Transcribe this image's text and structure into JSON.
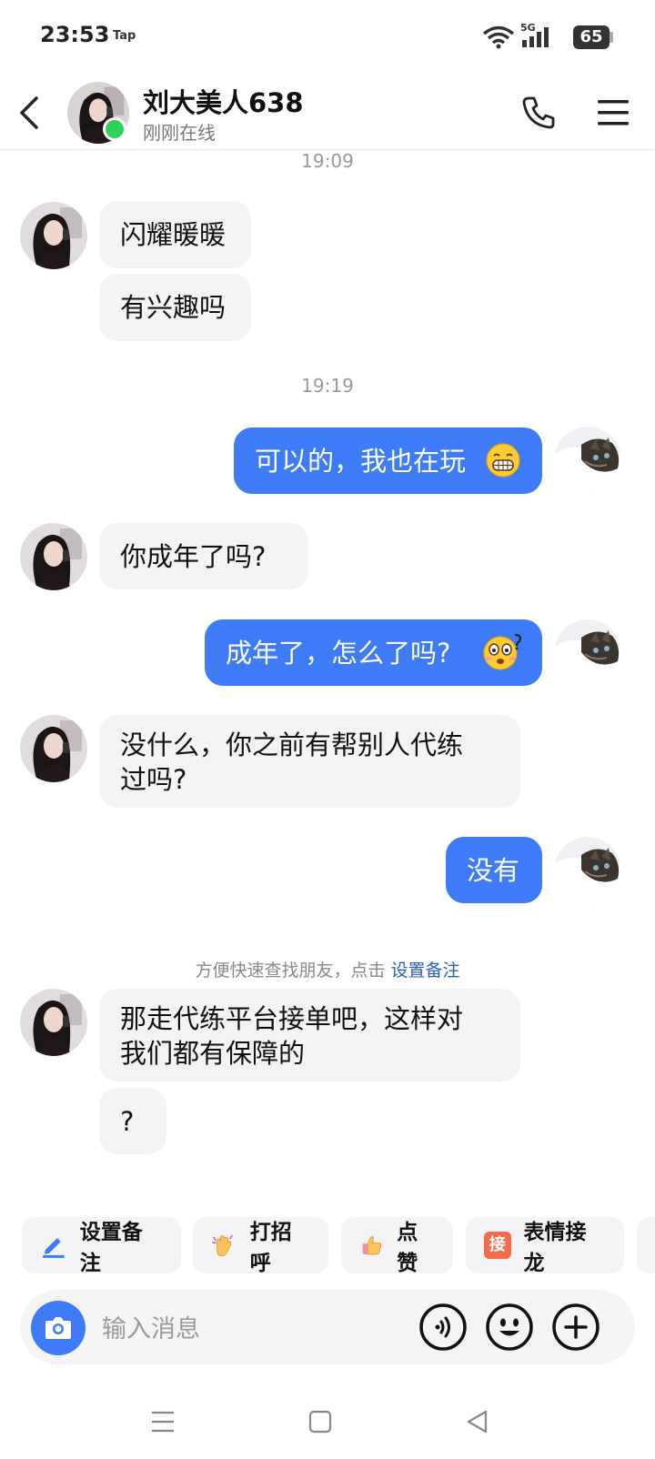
{
  "status_bar": {
    "time": "23:53",
    "tap_label": "Tap",
    "network": "5G",
    "battery": "65"
  },
  "header": {
    "name": "刘大美人638",
    "status": "刚刚在线"
  },
  "messages": [
    {
      "type": "time",
      "text": "19:09"
    },
    {
      "type": "incoming",
      "text": "闪耀暖暖"
    },
    {
      "type": "incoming",
      "text": "有兴趣吗"
    },
    {
      "type": "time",
      "text": "19:19"
    },
    {
      "type": "outgoing",
      "text": "可以的，我也在玩",
      "emoji": "grin"
    },
    {
      "type": "incoming",
      "text": "你成年了吗?"
    },
    {
      "type": "outgoing",
      "text": "成年了，怎么了吗?",
      "emoji": "shocked"
    },
    {
      "type": "incoming",
      "text": "没什么，你之前有帮别人代练过吗?",
      "lines": [
        "没什么，你之前有帮别人代练",
        "过吗?"
      ]
    },
    {
      "type": "outgoing",
      "text": "没有"
    },
    {
      "type": "incoming",
      "text": "那走代练平台接单吧，这样对我们都有保障的",
      "lines": [
        "那走代练平台接单吧，这样对",
        "我们都有保障的"
      ]
    },
    {
      "type": "incoming",
      "text": "?"
    }
  ],
  "notice": {
    "text": "方便快速查找朋友，点击 ",
    "link": "设置备注"
  },
  "quick_actions": [
    {
      "label": "设置备注",
      "icon": "pencil-icon"
    },
    {
      "label": "打招呼",
      "icon": "wave-hand-icon"
    },
    {
      "label": "点赞",
      "icon": "thumbs-up-icon"
    },
    {
      "label": "表情接龙",
      "icon": "jie-badge-icon",
      "badge": "接"
    }
  ],
  "input": {
    "placeholder": "输入消息"
  },
  "colors": {
    "accent": "#3e7bf6",
    "online": "#2ed15a",
    "bubble_in": "#f3f3f5"
  }
}
